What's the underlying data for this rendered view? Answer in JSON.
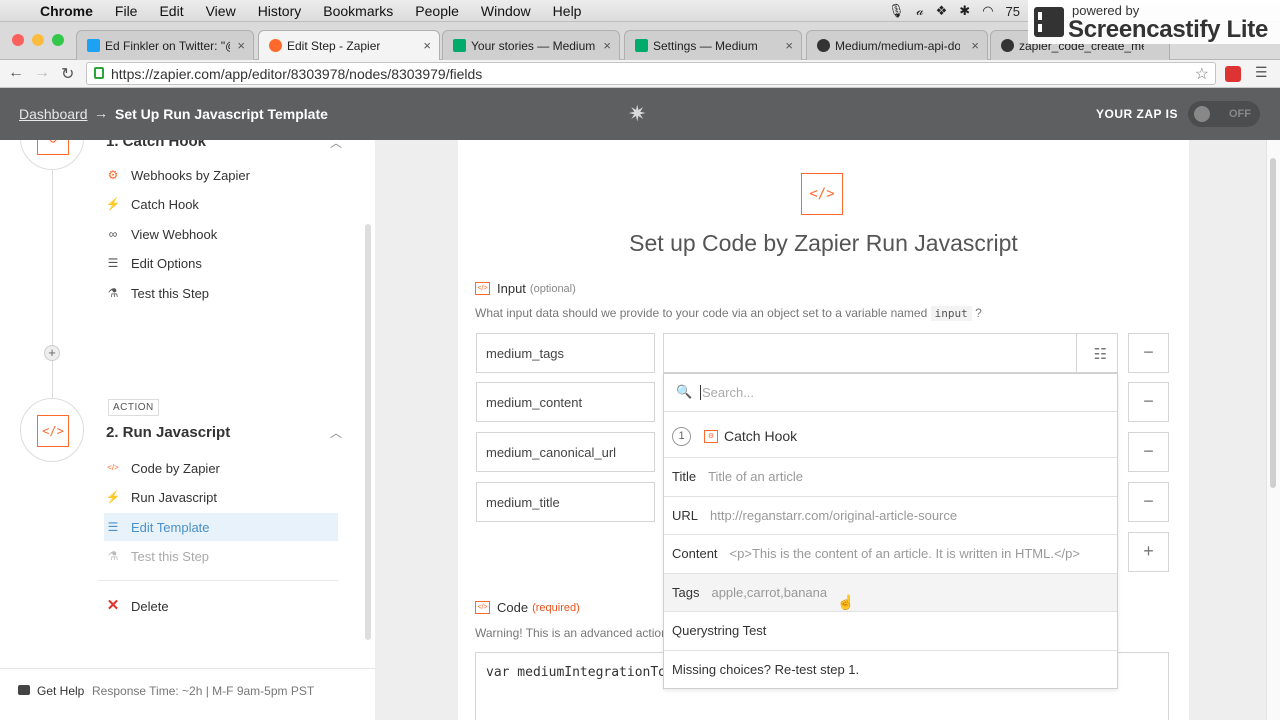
{
  "menubar": {
    "app": "Chrome",
    "items": [
      "File",
      "Edit",
      "View",
      "History",
      "Bookmarks",
      "People",
      "Window",
      "Help"
    ],
    "battery": "75"
  },
  "recorder": {
    "line1": "powered by",
    "line2": "Screencastify Lite"
  },
  "tabs": [
    {
      "label": "Ed Finkler on Twitter: \"@za",
      "color": "#1da1f2"
    },
    {
      "label": "Edit Step - Zapier",
      "color": "#ff6a2c"
    },
    {
      "label": "Your stories — Medium",
      "color": "#00ab6c"
    },
    {
      "label": "Settings — Medium",
      "color": "#00ab6c"
    },
    {
      "label": "Medium/medium-api-docs",
      "color": "#333333"
    },
    {
      "label": "zapier_code_create_medi",
      "color": "#333333"
    }
  ],
  "address": {
    "url": "https://zapier.com/app/editor/8303978/nodes/8303979/fields"
  },
  "header": {
    "dashboard": "Dashboard",
    "arrow": "→",
    "title": "Set Up Run Javascript Template",
    "zap_is": "YOUR ZAP IS",
    "toggle": "OFF"
  },
  "sidebar": {
    "step1_title": "1. Catch Hook",
    "step1_items": [
      {
        "icon": "⚙",
        "label": "Webhooks by Zapier"
      },
      {
        "icon": "⚡",
        "label": "Catch Hook"
      },
      {
        "icon": "∞",
        "label": "View Webhook"
      },
      {
        "icon": "☰",
        "label": "Edit Options"
      },
      {
        "icon": "⚗",
        "label": "Test this Step"
      }
    ],
    "action_badge": "ACTION",
    "step2_title": "2. Run Javascript",
    "step2_icon": "</>",
    "step2_items": [
      {
        "icon": "</>",
        "label": "Code by Zapier"
      },
      {
        "icon": "⚡",
        "label": "Run Javascript"
      },
      {
        "icon": "☰",
        "label": "Edit Template"
      },
      {
        "icon": "⚗",
        "label": "Test this Step"
      }
    ],
    "delete": "Delete",
    "help_label": "Get Help",
    "help_info": "Response Time: ~2h | M-F 9am-5pm PST"
  },
  "main": {
    "icon": "</>",
    "title": "Set up Code by Zapier Run Javascript",
    "input_label": "Input",
    "input_optional": "(optional)",
    "input_help": "What input data should we provide to your code via an object set to a variable named",
    "input_var": "input",
    "input_q": "?",
    "keys": [
      "medium_tags",
      "medium_content",
      "medium_canonical_url",
      "medium_title"
    ],
    "code_label": "Code",
    "code_required": "(required)",
    "warning": "Warning! This is an advanced action!",
    "code_first_line": "var mediumIntegrationToken = ",
    "minus": "−",
    "plus": "+"
  },
  "dropdown": {
    "search_placeholder": "Search...",
    "group_num": "1",
    "group_title": "Catch Hook",
    "rows": [
      {
        "key": "Title",
        "value": "Title of an article"
      },
      {
        "key": "URL",
        "value": "http://reganstarr.com/original-article-source"
      },
      {
        "key": "Content",
        "value": "<p>This is the content of an article. It is written in HTML.</p>"
      },
      {
        "key": "Tags",
        "value": "apple,carrot,banana"
      },
      {
        "key": "Querystring Test",
        "value": ""
      },
      {
        "key": "Missing choices? Re-test step 1.",
        "value": ""
      }
    ]
  }
}
